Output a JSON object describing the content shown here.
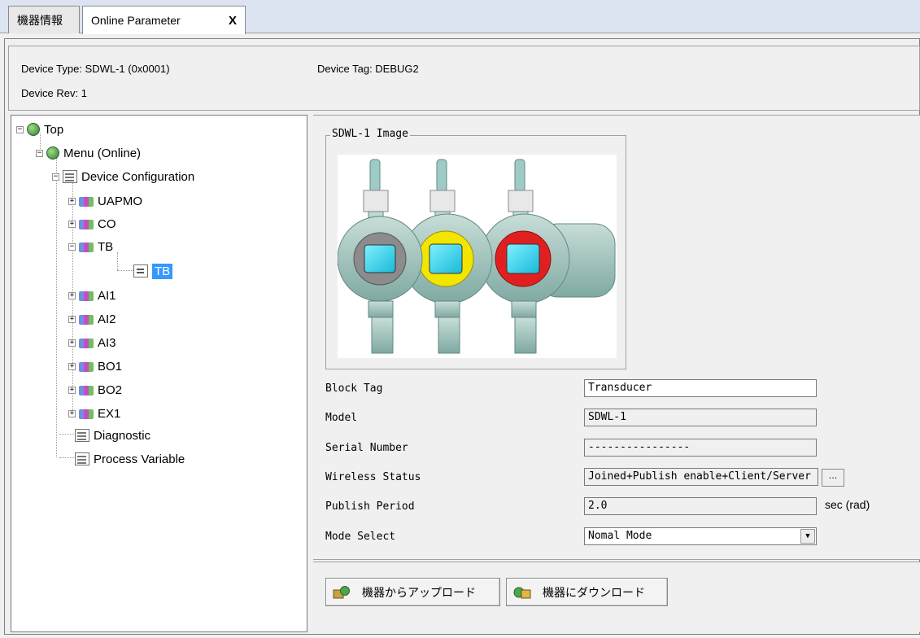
{
  "tabs": [
    {
      "label": "機器情報"
    },
    {
      "label": "Online Parameter",
      "close": "X"
    }
  ],
  "header": {
    "device_type": "Device Type: SDWL-1 (0x0001)",
    "device_tag": "Device Tag: DEBUG2",
    "device_rev": "Device Rev:  1"
  },
  "tree": {
    "top": "Top",
    "menu": "Menu (Online)",
    "device_configuration": "Device Configuration",
    "blocks": [
      "UAPMO",
      "CO",
      "TB",
      "AI1",
      "AI2",
      "AI3",
      "BO1",
      "BO2",
      "EX1"
    ],
    "tb_child": "TB",
    "diagnostic": "Diagnostic",
    "process_variable": "Process Variable"
  },
  "panel": {
    "image_group_title": "SDWL-1 Image",
    "fields": {
      "block_tag": {
        "label": "Block Tag",
        "value": "Transducer"
      },
      "model": {
        "label": "Model",
        "value": "SDWL-1"
      },
      "serial_number": {
        "label": "Serial Number",
        "value": "----------------"
      },
      "wireless_status": {
        "label": "Wireless Status",
        "value": "Joined+Publish enable+Client/Server",
        "button": "..."
      },
      "publish_period": {
        "label": "Publish Period",
        "value": "2.0",
        "unit": "sec (rad)"
      },
      "mode_select": {
        "label": "Mode Select",
        "value": "Nomal Mode"
      }
    }
  },
  "buttons": {
    "upload": "機器からアップロード",
    "download": "機器にダウンロード"
  },
  "colors": {
    "selection": "#3399ff",
    "tab_bar": "#dce4f2",
    "device_body": "#9fbfb8",
    "display_glass": "#3fd0e8",
    "ring_yellow": "#f2e500",
    "ring_red": "#e02020",
    "ring_grey": "#8c8c8c"
  },
  "icons": {
    "top": "globe-icon",
    "menu": "globe-menu-icon",
    "folder": "menu-page-icon",
    "block": "block-icon",
    "leaf": "parameter-page-icon",
    "upload": "upload-icon",
    "download": "download-icon"
  }
}
